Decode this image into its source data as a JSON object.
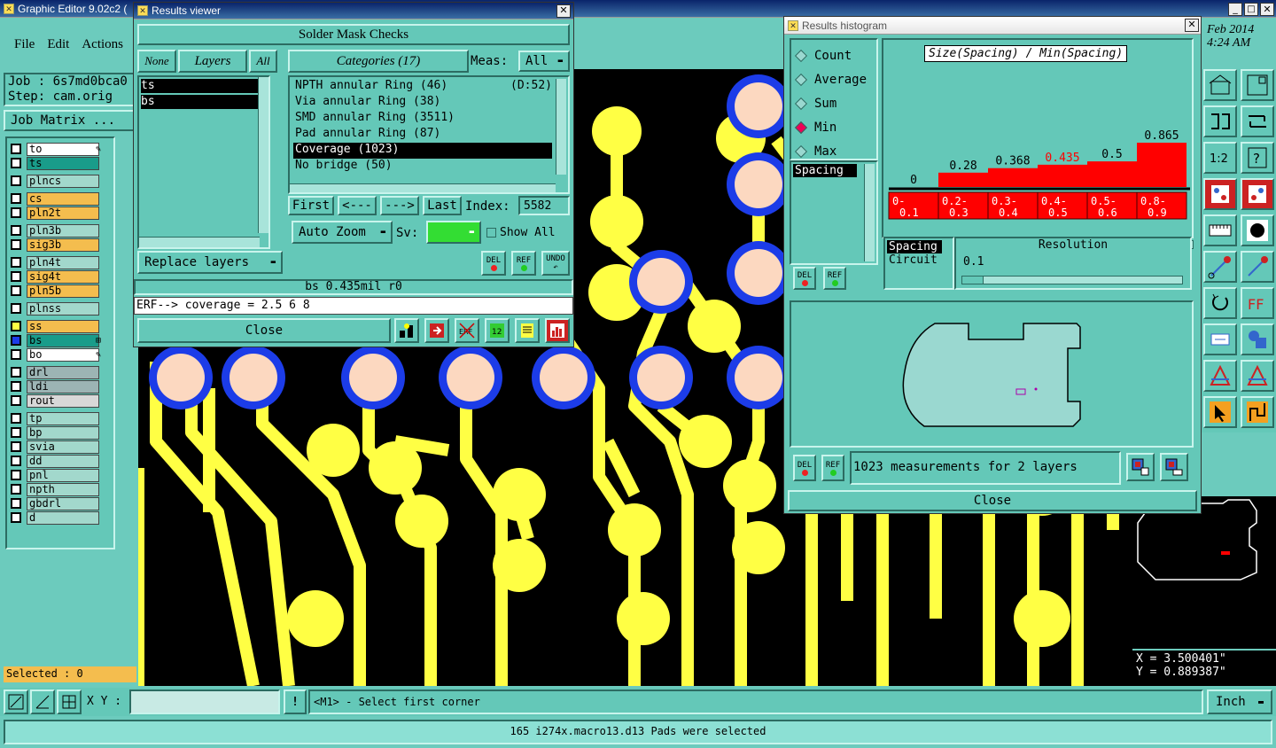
{
  "main_window": {
    "title": "Graphic Editor 9.02c2 (",
    "menu": [
      "File",
      "Edit",
      "Actions"
    ],
    "job_label": "Job : 6s7md0bca0",
    "step_label": "Step: cam.orig",
    "job_matrix": "Job Matrix ...",
    "date": "Feb 2014",
    "time": "4:24 AM",
    "selected": "Selected : 0",
    "xy_label": "X Y :",
    "xy_value": "",
    "prompt": "<M1> - Select first corner",
    "units": "Inch",
    "status_bar": "165 i274x.macro13.d13 Pads were selected",
    "coord_x": "X = 3.500401\"",
    "coord_y": "Y = 0.889387\""
  },
  "layers": [
    {
      "name": "to",
      "color": "#ffffff",
      "mark": "✎"
    },
    {
      "name": "ts",
      "color": "#199c8a",
      "mark": ""
    },
    {
      "name": "plncs",
      "color": "#a2d8cc",
      "mark": ""
    },
    {
      "name": "cs",
      "color": "#f4bd4e",
      "mark": ""
    },
    {
      "name": "pln2t",
      "color": "#f4bd4e",
      "mark": ""
    },
    {
      "name": "pln3b",
      "color": "#a2d8cc",
      "mark": ""
    },
    {
      "name": "sig3b",
      "color": "#f4bd4e",
      "mark": ""
    },
    {
      "name": "pln4t",
      "color": "#a2d8cc",
      "mark": ""
    },
    {
      "name": "sig4t",
      "color": "#f4bd4e",
      "mark": ""
    },
    {
      "name": "pln5b",
      "color": "#f4bd4e",
      "mark": ""
    },
    {
      "name": "plnss",
      "color": "#a2d8cc",
      "mark": ""
    },
    {
      "name": "ss",
      "color": "#f4bd4e",
      "mark": ""
    },
    {
      "name": "bs",
      "color": "#199c8a",
      "mark": "⊞"
    },
    {
      "name": "bo",
      "color": "#ffffff",
      "mark": "✎"
    },
    {
      "name": "drl",
      "color": "#9cb4b4",
      "mark": ""
    },
    {
      "name": "ldi",
      "color": "#9cb4b4",
      "mark": ""
    },
    {
      "name": "rout",
      "color": "#d8d8d8",
      "mark": ""
    },
    {
      "name": "tp",
      "color": "#a2d8cc",
      "mark": ""
    },
    {
      "name": "bp",
      "color": "#a2d8cc",
      "mark": ""
    },
    {
      "name": "svia",
      "color": "#a2d8cc",
      "mark": ""
    },
    {
      "name": "dd",
      "color": "#a2d8cc",
      "mark": ""
    },
    {
      "name": "pnl",
      "color": "#a2d8cc",
      "mark": ""
    },
    {
      "name": "npth",
      "color": "#a2d8cc",
      "mark": ""
    },
    {
      "name": "gbdrl",
      "color": "#a2d8cc",
      "mark": ""
    },
    {
      "name": "d",
      "color": "#a2d8cc",
      "mark": ""
    }
  ],
  "results_viewer": {
    "title": "Results viewer",
    "header": "Solder Mask Checks",
    "none_btn": "None",
    "layers_btn": "Layers",
    "all_btn": "All",
    "layer_list": [
      "ts",
      "bs"
    ],
    "categories_btn": "Categories (17)",
    "meas_label": "Meas:",
    "meas_value": "All",
    "categories": [
      {
        "label": "NPTH annular Ring (46)",
        "extra": "(D:52)"
      },
      {
        "label": "Via annular Ring (38)",
        "extra": ""
      },
      {
        "label": "SMD annular Ring (3511)",
        "extra": ""
      },
      {
        "label": "Pad annular Ring (87)",
        "extra": ""
      },
      {
        "label": "Coverage (1023)",
        "extra": ""
      },
      {
        "label": "No bridge (50)",
        "extra": ""
      }
    ],
    "first": "First",
    "prev": "<---",
    "next": "--->",
    "last": "Last",
    "index_label": "Index:",
    "index_value": "5582",
    "auto_zoom": "Auto Zoom",
    "sv_label": "Sv:",
    "show_all": "Show All",
    "replace_layers": "Replace layers",
    "info_line": "bs 0.435mil  r0",
    "erf_line": "ERF--> coverage = 2.5 6 8",
    "close": "Close",
    "del": "DEL",
    "ref": "REF",
    "undo": "UNDO"
  },
  "histogram": {
    "title": "Results histogram",
    "modes": [
      "Count",
      "Average",
      "Sum",
      "Min",
      "Max"
    ],
    "selected_mode": "Min",
    "chart_title": "Size(Spacing) / Min(Spacing)",
    "list_item": "Spacing",
    "spacing": "Spacing",
    "circuit": "Circuit",
    "resolution_label": "Resolution",
    "resolution_value": "0.1",
    "measurements": "1023 measurements for 2 layers",
    "close": "Close",
    "del": "DEL",
    "ref": "REF"
  },
  "chart_data": {
    "type": "bar",
    "title": "Size(Spacing) / Min(Spacing)",
    "categories": [
      "0-0.1",
      "0.2-0.3",
      "0.3-0.4",
      "0.4-0.5",
      "0.5-0.6",
      "0.8-0.9"
    ],
    "value_labels": [
      "0",
      "0.28",
      "0.368",
      "0.435",
      "0.5",
      "0.865"
    ],
    "values": [
      0,
      0.28,
      0.368,
      0.435,
      0.5,
      0.865
    ],
    "highlight_index": 3,
    "highlight_color": "#ff0000",
    "bar_color": "#ff0000"
  },
  "colors": {
    "board": "#000000",
    "trace": "#ffff44",
    "pad": "#fcd8c0",
    "ring": "#1c3ce8",
    "panel": "#64c8b8"
  }
}
